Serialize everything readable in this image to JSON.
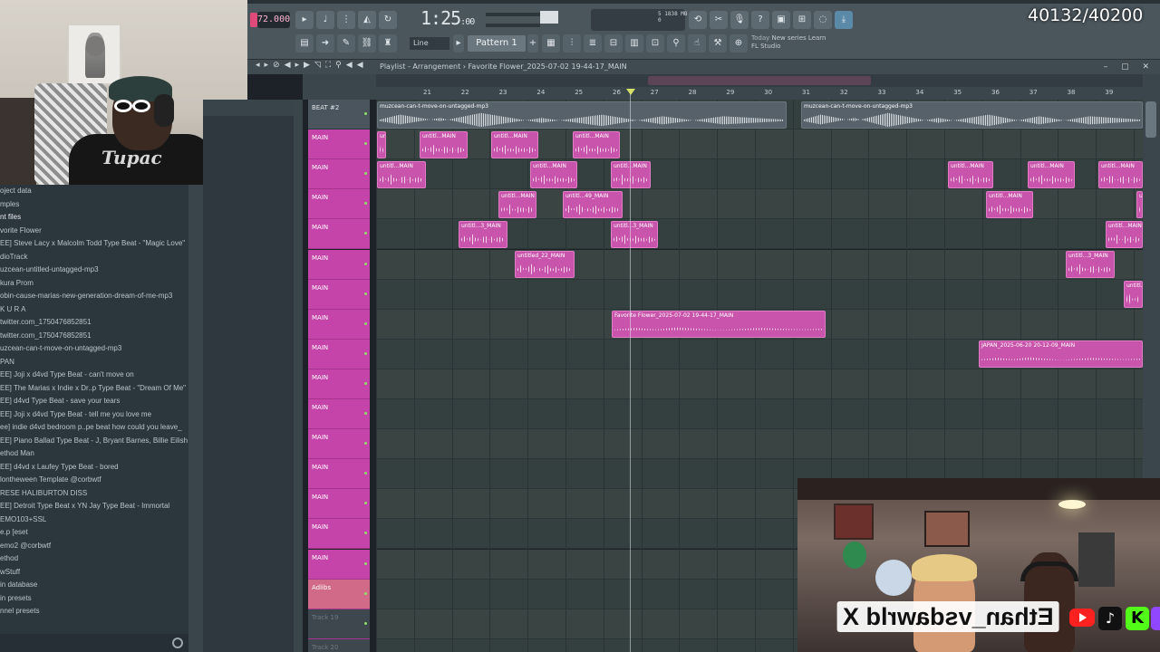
{
  "stream": {
    "counter": "40132/40200",
    "handle": "Ethan_vsdawrld",
    "handle_x": "X"
  },
  "toolbar": {
    "tempo": "72.000",
    "time_main": "1:25",
    "time_sub": ":00",
    "snap": "Line",
    "pattern": "Pattern 1",
    "cpu": "1838 MB",
    "cpu_val": "0",
    "cpu_num": "5",
    "news_today": "Today",
    "news_text": "New series Learn",
    "news_app": "FL Studio"
  },
  "playlist": {
    "title": "Playlist - Arrangement",
    "separator": "›",
    "song": "Favorite Flower_2025-07-02 19-44-17_MAIN",
    "ruler": [
      "21",
      "22",
      "23",
      "24",
      "25",
      "26",
      "27",
      "28",
      "29",
      "30",
      "31",
      "32",
      "33",
      "34",
      "35",
      "36",
      "37",
      "38",
      "39"
    ]
  },
  "tracks": [
    {
      "name": "BEAT #2",
      "kind": "beat"
    },
    {
      "name": "MAIN",
      "kind": "main"
    },
    {
      "name": "MAIN",
      "kind": "main"
    },
    {
      "name": "MAIN",
      "kind": "main"
    },
    {
      "name": "MAIN",
      "kind": "main"
    },
    {
      "name": "MAIN",
      "kind": "main"
    },
    {
      "name": "MAIN",
      "kind": "main"
    },
    {
      "name": "MAIN",
      "kind": "main"
    },
    {
      "name": "MAIN",
      "kind": "main"
    },
    {
      "name": "MAIN",
      "kind": "main"
    },
    {
      "name": "MAIN",
      "kind": "main"
    },
    {
      "name": "MAIN",
      "kind": "main"
    },
    {
      "name": "MAIN",
      "kind": "main"
    },
    {
      "name": "MAIN",
      "kind": "main"
    },
    {
      "name": "MAIN",
      "kind": "main"
    },
    {
      "name": "MAIN",
      "kind": "main"
    },
    {
      "name": "Adlibs",
      "kind": "adlib"
    },
    {
      "name": "Track 19",
      "kind": "empty"
    },
    {
      "name": "Track 20",
      "kind": "empty"
    }
  ],
  "clip_labels": {
    "beat": "muzcean-can-t-move-on-untagged-mp3",
    "untitl": "untitl...MAIN",
    "untitl_49": "untitl...49_MAIN",
    "untitl_3": "untitl...3_MAIN",
    "untitled_22": "untitled_22_MAIN",
    "fav": "Favorite Flower_2025-07-02 19-44-17_MAIN",
    "japan": "JAPAN_2025-06-20 20-12-09_MAIN"
  },
  "browser": {
    "items": [
      "oject data",
      "mples",
      "nt files",
      "vorite Flower",
      "EE] Steve Lacy x Malcolm Todd Type Beat - \"Magic Love\"",
      "dioTrack",
      "uzcean-untitled-untagged-mp3",
      "kura Prom",
      "obin-cause-marias-new-generation-dream-of-me-mp3",
      "K U R A",
      "twitter.com_1750476852851",
      "twitter.com_1750476852851",
      "uzcean-can-t-move-on-untagged-mp3",
      "PAN",
      "EE] Joji x d4vd Type Beat - can't move on",
      "EE] The Marias x Indie x Dr..p Type Beat - \"Dream Of Me\"",
      "EE] d4vd Type Beat - save your tears",
      "EE] Joji x d4vd Type Beat - tell me you love me",
      "ee] indie  d4vd  bedroom p..pe beat  how could you leave_",
      "EE] Piano Ballad Type Beat - J, Bryant Barnes, Billie Eilish",
      "ethod Man",
      "EE] d4vd x Laufey Type Beat - bored",
      "lontheween Template @corbwtf",
      "RESE HALIBURTON DISS",
      "EE] Detroit Type Beat x YN Jay Type Beat - Immortal",
      "EMO103+SSL",
      "e.p [eset",
      "emo2 @corbwtf",
      "ethod",
      "wStuff",
      "in database",
      "in presets",
      "nnel presets"
    ]
  },
  "colors": {
    "track_main": "#c544a9",
    "clip": "#c954ab",
    "lane": "#34403f",
    "toolbar": "#4a555c"
  }
}
